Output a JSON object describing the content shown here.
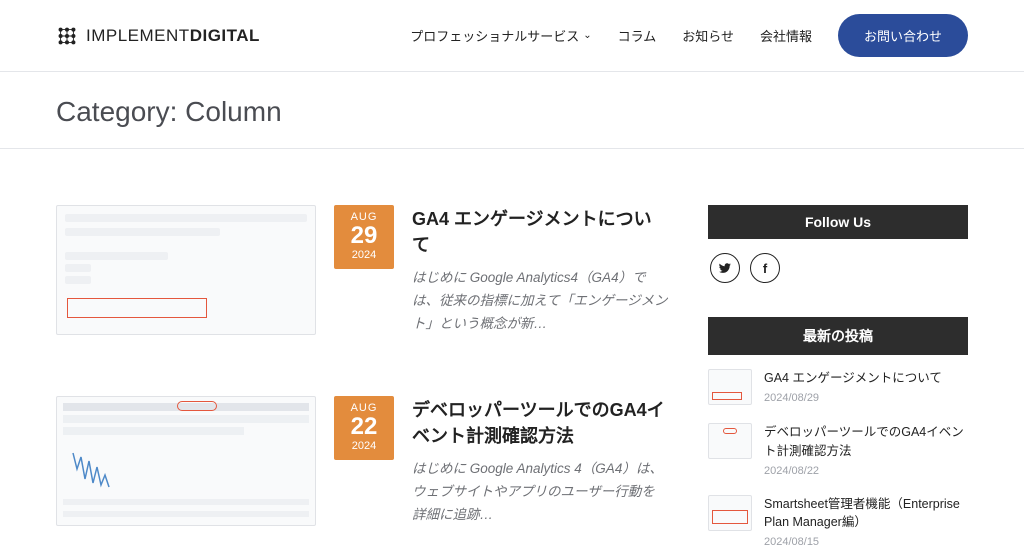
{
  "brand": {
    "light": "IMPLEMENT",
    "bold": "DIGITAL"
  },
  "nav": {
    "professional": "プロフェッショナルサービス",
    "column": "コラム",
    "news": "お知らせ",
    "company": "会社情報",
    "contact": "お問い合わせ"
  },
  "page_title": "Category: Column",
  "posts": [
    {
      "month": "AUG",
      "day": "29",
      "year": "2024",
      "title": "GA4 エンゲージメントについて",
      "excerpt": "はじめに Google Analytics4（GA4）では、従来の指標に加えて「エンゲージメント」という概念が新…"
    },
    {
      "month": "AUG",
      "day": "22",
      "year": "2024",
      "title": "デベロッパーツールでのGA4イベント計測確認方法",
      "excerpt": "はじめに Google Analytics 4（GA4）は、ウェブサイトやアプリのユーザー行動を詳細に追跡…"
    }
  ],
  "sidebar": {
    "follow_heading": "Follow Us",
    "recent_heading": "最新の投稿",
    "recent": [
      {
        "title": "GA4 エンゲージメントについて",
        "date": "2024/08/29"
      },
      {
        "title": "デベロッパーツールでのGA4イベント計測確認方法",
        "date": "2024/08/22"
      },
      {
        "title": "Smartsheet管理者機能（Enterprise Plan Manager編）",
        "date": "2024/08/15"
      }
    ]
  }
}
